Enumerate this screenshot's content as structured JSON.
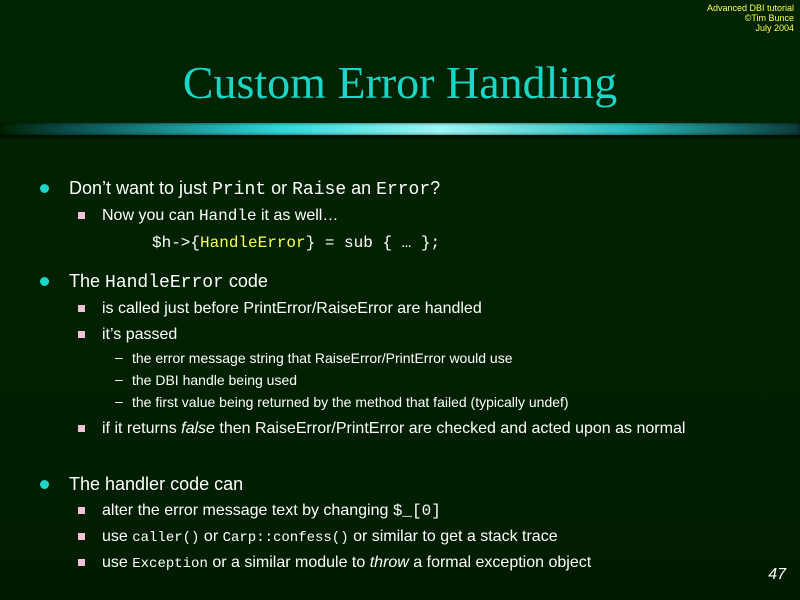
{
  "header": {
    "corner_lines": [
      "Advanced DBI tutorial",
      "©Tim Bunce",
      "July 2004"
    ],
    "title": "Custom Error Handling"
  },
  "bullets": {
    "b1": {
      "pre": "Don’t want to just ",
      "code1": "Print",
      "mid1": " or ",
      "code2": "Raise",
      "mid2": " an ",
      "code3": "Error",
      "post": "?"
    },
    "b1_sub1": {
      "pre": "Now you can ",
      "code": "Handle",
      "post": " it as well…"
    },
    "b1_code": {
      "part1": "$h->{",
      "part2": "HandleError",
      "part3": "} = sub { … };"
    },
    "b2": {
      "pre": "The ",
      "code": "HandleError",
      "post": " code"
    },
    "b2_sub1": "is called just before PrintError/RaiseError are handled",
    "b2_sub2": "it’s passed",
    "b2_sub2_items": [
      "the error message string that RaiseError/PrintError would use",
      "the DBI handle being used",
      "the first value being returned by the method that failed (typically undef)"
    ],
    "b2_sub3": {
      "pre": "if it returns ",
      "em": "false",
      "post": " then RaiseError/PrintError are checked and acted upon as normal"
    },
    "b3": "The handler code can",
    "b3_sub1": {
      "pre": "alter the error message text by changing ",
      "code": "$_[0]"
    },
    "b3_sub2": {
      "pre": "use ",
      "code1": "caller()",
      "mid": " or ",
      "code2": "Carp::confess()",
      "post": " or similar to get a stack trace"
    },
    "b3_sub3": {
      "pre": "use ",
      "code": "Exception",
      "mid": " or a similar module to ",
      "em": "throw",
      "post": " a formal exception object"
    }
  },
  "footer": {
    "page_number": "47"
  },
  "colors": {
    "background": "#002200",
    "title": "#19d6c8",
    "bullet_circle": "#19d6c8",
    "bullet_square": "#f3c2d6",
    "corner_text": "#ffff55",
    "highlight_code": "#ffff55"
  },
  "icons": {
    "level1_bullet": "circle-bullet-icon",
    "level2_bullet": "square-bullet-icon",
    "level3_bullet": "dash-bullet-icon"
  }
}
